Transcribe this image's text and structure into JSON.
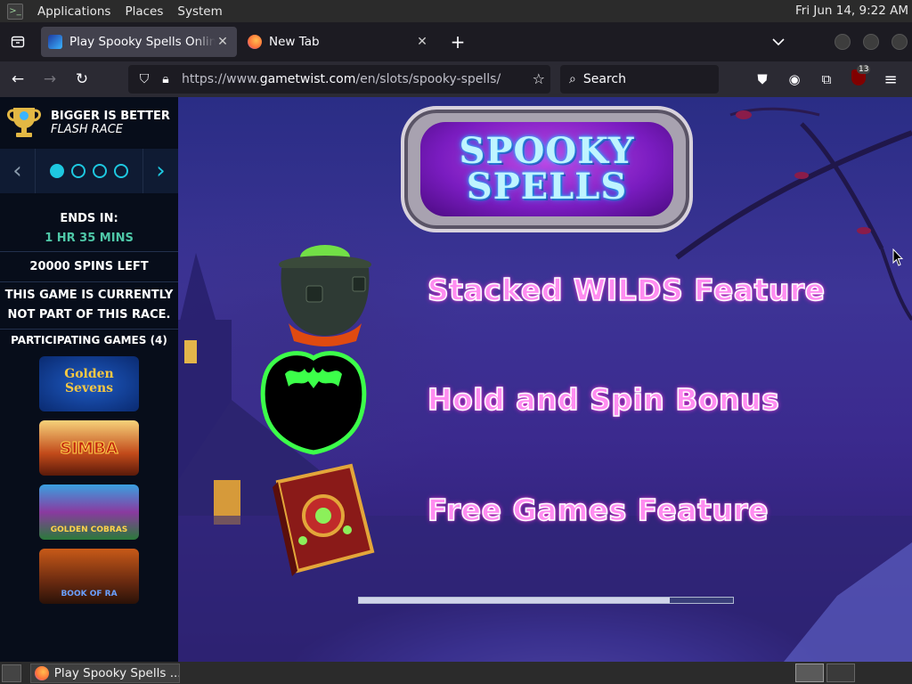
{
  "panel": {
    "menus": [
      "Applications",
      "Places",
      "System"
    ],
    "clock": "Fri Jun 14,  9:22 AM"
  },
  "browser": {
    "tabs": [
      {
        "title": "Play Spooky Spells Online For Free",
        "active": true
      },
      {
        "title": "New Tab",
        "active": false
      }
    ],
    "url": {
      "prefix": "https://www.",
      "domain": "gametwist.com",
      "path": "/en/slots/spooky-spells/"
    },
    "search_placeholder": "Search",
    "ublock_count": "13"
  },
  "sidebar": {
    "race_title": "BIGGER IS BETTER",
    "race_subtitle": "FLASH RACE",
    "collapse_icon": "«",
    "pager": {
      "total": 4,
      "active": 1
    },
    "ends_in_label": "ENDS IN:",
    "ends_in_value": "1 HR 35 MINS",
    "spins_left": "20000 SPINS LEFT",
    "not_part_line1": "THIS GAME IS CURRENTLY",
    "not_part_line2": "NOT PART OF THIS RACE.",
    "participating_label": "PARTICIPATING GAMES (4)",
    "games": [
      "Golden Sevens",
      "SIMBA",
      "GOLDEN COBRAS",
      "BOOK OF RA"
    ]
  },
  "game": {
    "logo_line1": "SPOOKY",
    "logo_line2": "SPELLS",
    "features": [
      {
        "icon": "cauldron-icon",
        "label": "Stacked WILDS Feature"
      },
      {
        "icon": "bat-icon",
        "label": "Hold and Spin Bonus"
      },
      {
        "icon": "spellbook-icon",
        "label": "Free Games Feature"
      }
    ],
    "loading_progress": 0.83
  },
  "taskbar": {
    "window_title": "Play Spooky Spells ..."
  }
}
